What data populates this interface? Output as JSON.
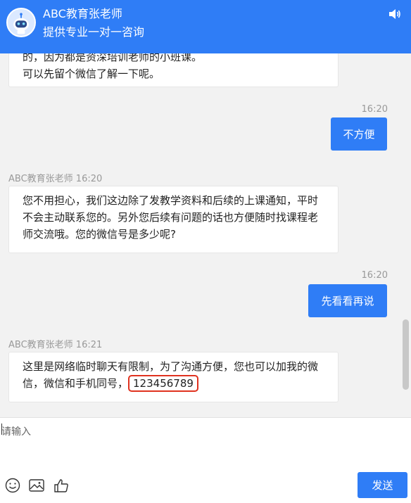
{
  "header": {
    "agent_name": "ABC教育张老师",
    "subtitle": "提供专业一对一咨询"
  },
  "messages": {
    "m1_line1": "的，因为都是资深培训老师的小班课。",
    "m1_line2": "可以先留个微信了解一下呢。",
    "m2_time": "16:20",
    "m2_text": "不方便",
    "m3_sender": "ABC教育张老师 16:20",
    "m3_line1": "您不用担心，我们这边除了发教学资料和后续的上课通知，平时",
    "m3_line2": "不会主动联系您的。另外您后续有问题的话也方便随时找课程老",
    "m3_line3": "师交流哦。您的微信号是多少呢?",
    "m4_time": "16:20",
    "m4_text": "先看看再说",
    "m5_sender": "ABC教育张老师 16:21",
    "m5_line1": "这里是网络临时聊天有限制，为了沟通方便，您也可以加我的微",
    "m5_line2_prefix": "信，微信和手机同号，",
    "m5_number": "123456789"
  },
  "composer": {
    "placeholder": "请输入",
    "send_label": "发送"
  },
  "icons": {
    "emoji": "smiley-icon",
    "image": "image-icon",
    "like": "thumbs-up-icon",
    "sound": "speaker-icon"
  },
  "colors": {
    "brand_blue": "#2f7df6",
    "highlight_red": "#e0321f"
  }
}
